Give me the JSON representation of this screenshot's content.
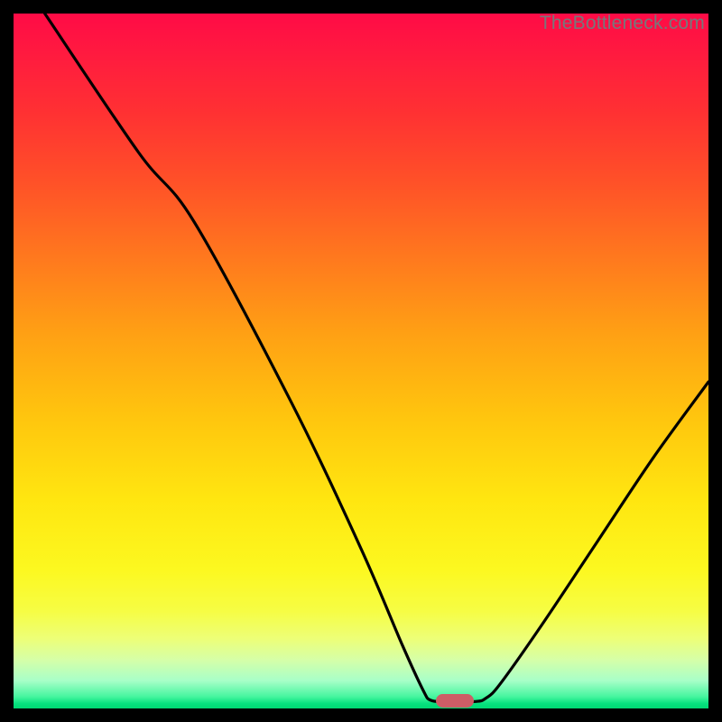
{
  "watermark": "TheBottleneck.com",
  "chart_data": {
    "type": "line",
    "title": "",
    "xlabel": "",
    "ylabel": "",
    "xlim": [
      0,
      100
    ],
    "ylim": [
      0,
      100
    ],
    "curve": [
      {
        "x": 4.5,
        "y": 100
      },
      {
        "x": 18,
        "y": 80
      },
      {
        "x": 26,
        "y": 70
      },
      {
        "x": 40,
        "y": 44
      },
      {
        "x": 50,
        "y": 23
      },
      {
        "x": 56,
        "y": 9
      },
      {
        "x": 59,
        "y": 2.5
      },
      {
        "x": 60,
        "y": 1.2
      },
      {
        "x": 62,
        "y": 1.0
      },
      {
        "x": 66.5,
        "y": 1.0
      },
      {
        "x": 68,
        "y": 1.5
      },
      {
        "x": 70,
        "y": 3.5
      },
      {
        "x": 76,
        "y": 12
      },
      {
        "x": 84,
        "y": 24
      },
      {
        "x": 92,
        "y": 36
      },
      {
        "x": 100,
        "y": 47
      }
    ],
    "marker": {
      "x": 63.5,
      "y": 1.0
    },
    "gradient_stops": [
      {
        "pos": 0,
        "color": "#ff0b46"
      },
      {
        "pos": 50,
        "color": "#ffb010"
      },
      {
        "pos": 80,
        "color": "#fcf820"
      },
      {
        "pos": 100,
        "color": "#00d873"
      }
    ]
  }
}
